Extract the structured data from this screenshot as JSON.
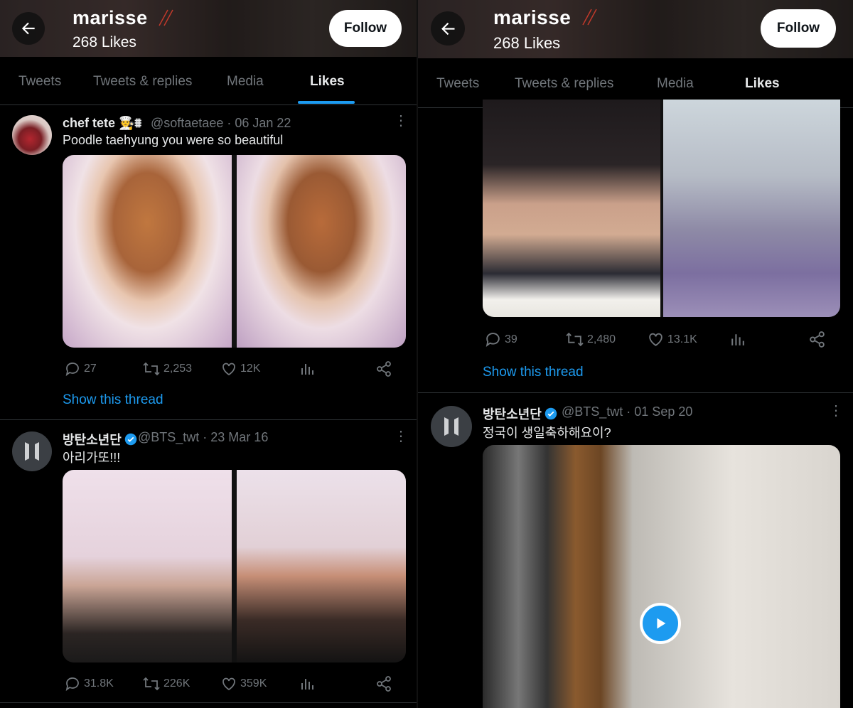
{
  "profile": {
    "name": "marisse",
    "likes_count": "268 Likes",
    "follow_label": "Follow"
  },
  "tabs": [
    {
      "label": "Tweets",
      "active": false
    },
    {
      "label": "Tweets & replies",
      "active": false
    },
    {
      "label": "Media",
      "active": false
    },
    {
      "label": "Likes",
      "active": true
    }
  ],
  "left": {
    "tweets": [
      {
        "name": "chef tete 🧑‍🍳⩩",
        "handle_date": "@softaetaee · 06 Jan 22",
        "text": "Poodle taehyung you were so beautiful",
        "replies": "27",
        "retweets": "2,253",
        "likes": "12K",
        "show_thread": "Show this thread"
      },
      {
        "name": "방탄소년단",
        "verified": true,
        "handle_date": "@BTS_twt · 23 Mar 16",
        "text": "아리가또!!!",
        "replies": "31.8K",
        "retweets": "226K",
        "likes": "359K"
      }
    ]
  },
  "right": {
    "tweet1": {
      "replies": "39",
      "retweets": "2,480",
      "likes": "13.1K",
      "show_thread": "Show this thread"
    },
    "tweet2": {
      "name": "방탄소년단",
      "verified": true,
      "handle_date": "@BTS_twt · 01 Sep 20",
      "text": "정국이 생일축하해요이?"
    }
  },
  "colors": {
    "accent": "#1d9bf0",
    "background": "#000000",
    "text_primary": "#e7e9ea",
    "text_secondary": "#71767b",
    "border": "#2f3336"
  },
  "icons": [
    "back-arrow-icon",
    "reply-icon",
    "retweet-icon",
    "like-icon",
    "views-icon",
    "share-icon",
    "more-icon",
    "verified-icon",
    "play-icon"
  ]
}
